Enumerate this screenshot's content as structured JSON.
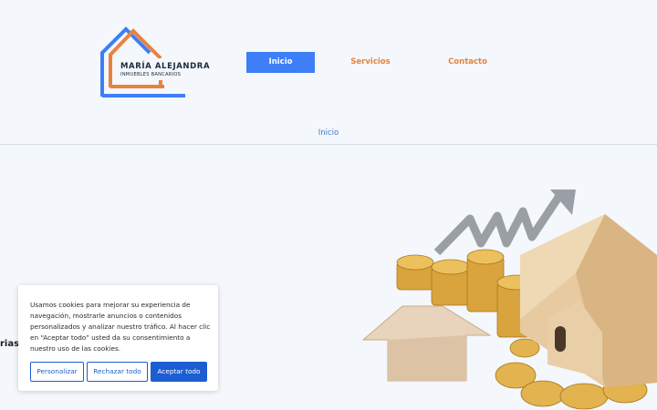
{
  "logo": {
    "name": "MARÍA ALEJANDRA",
    "subtitle": "INMUEBLES BANCARIOS"
  },
  "nav": {
    "items": [
      {
        "label": "Inicio"
      },
      {
        "label": "Servicios"
      },
      {
        "label": "Contacto"
      }
    ]
  },
  "breadcrumb": {
    "label": "Inicio"
  },
  "hero": {
    "partial_text": "rias"
  },
  "cookie": {
    "text": "Usamos cookies para mejorar su experiencia de navegación, mostrarle anuncios o contenidos personalizados y analizar nuestro tráfico. Al hacer clic en “Aceptar todo” usted da su consentimiento a nuestro uso de las cookies.",
    "buttons": {
      "customize": "Personalizar",
      "reject": "Rechazar todo",
      "accept": "Aceptar todo"
    }
  },
  "colors": {
    "accent_blue": "#3e7ef6",
    "accent_orange": "#e8823f",
    "cookie_blue": "#1c5ed1"
  }
}
